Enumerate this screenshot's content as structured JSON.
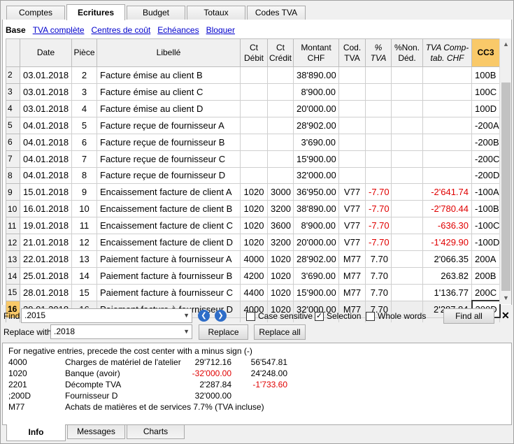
{
  "top_tabs": [
    "Comptes",
    "Ecritures",
    "Budget",
    "Totaux",
    "Codes TVA"
  ],
  "views": {
    "base": "Base",
    "links": [
      "TVA complète",
      "Centres de coût",
      "Echéances",
      "Bloquer"
    ]
  },
  "columns": [
    "Date",
    "Pièce",
    "Libellé",
    "Ct Débit",
    "Ct Crédit",
    "Montant CHF",
    "Cod. TVA",
    "% TVA",
    "%Non. Déd.",
    "TVA Comp-tab. CHF",
    "CC3"
  ],
  "rows": [
    {
      "n": "2",
      "date": "03.01.2018",
      "piece": "2",
      "libelle": "Facture émise au client B",
      "debit": "",
      "credit": "",
      "montant": "38'890.00",
      "codtva": "",
      "pct": "",
      "nonded": "",
      "tvacomp": "",
      "cc3": "100B"
    },
    {
      "n": "3",
      "date": "03.01.2018",
      "piece": "3",
      "libelle": "Facture émise au client C",
      "debit": "",
      "credit": "",
      "montant": "8'900.00",
      "codtva": "",
      "pct": "",
      "nonded": "",
      "tvacomp": "",
      "cc3": "100C"
    },
    {
      "n": "4",
      "date": "03.01.2018",
      "piece": "4",
      "libelle": "Facture émise au client D",
      "debit": "",
      "credit": "",
      "montant": "20'000.00",
      "codtva": "",
      "pct": "",
      "nonded": "",
      "tvacomp": "",
      "cc3": "100D"
    },
    {
      "n": "5",
      "date": "04.01.2018",
      "piece": "5",
      "libelle": "Facture reçue de fournisseur A",
      "debit": "",
      "credit": "",
      "montant": "28'902.00",
      "codtva": "",
      "pct": "",
      "nonded": "",
      "tvacomp": "",
      "cc3": "-200A"
    },
    {
      "n": "6",
      "date": "04.01.2018",
      "piece": "6",
      "libelle": "Facture reçue de fournisseur B",
      "debit": "",
      "credit": "",
      "montant": "3'690.00",
      "codtva": "",
      "pct": "",
      "nonded": "",
      "tvacomp": "",
      "cc3": "-200B"
    },
    {
      "n": "7",
      "date": "04.01.2018",
      "piece": "7",
      "libelle": "Facture reçue de fournisseur C",
      "debit": "",
      "credit": "",
      "montant": "15'900.00",
      "codtva": "",
      "pct": "",
      "nonded": "",
      "tvacomp": "",
      "cc3": "-200C"
    },
    {
      "n": "8",
      "date": "04.01.2018",
      "piece": "8",
      "libelle": "Facture reçue de fournisseur D",
      "debit": "",
      "credit": "",
      "montant": "32'000.00",
      "codtva": "",
      "pct": "",
      "nonded": "",
      "tvacomp": "",
      "cc3": "-200D"
    },
    {
      "n": "9",
      "date": "15.01.2018",
      "piece": "9",
      "libelle": "Encaissement facture de client A",
      "debit": "1020",
      "credit": "3000",
      "montant": "36'950.00",
      "codtva": "V77",
      "pct": "-7.70",
      "nonded": "",
      "tvacomp": "-2'641.74",
      "cc3": "-100A"
    },
    {
      "n": "10",
      "date": "16.01.2018",
      "piece": "10",
      "libelle": "Encaissement facture de client B",
      "debit": "1020",
      "credit": "3200",
      "montant": "38'890.00",
      "codtva": "V77",
      "pct": "-7.70",
      "nonded": "",
      "tvacomp": "-2'780.44",
      "cc3": "-100B"
    },
    {
      "n": "11",
      "date": "19.01.2018",
      "piece": "11",
      "libelle": "Encaissement facture de client C",
      "debit": "1020",
      "credit": "3600",
      "montant": "8'900.00",
      "codtva": "V77",
      "pct": "-7.70",
      "nonded": "",
      "tvacomp": "-636.30",
      "cc3": "-100C"
    },
    {
      "n": "12",
      "date": "21.01.2018",
      "piece": "12",
      "libelle": "Encaissement facture de client D",
      "debit": "1020",
      "credit": "3200",
      "montant": "20'000.00",
      "codtva": "V77",
      "pct": "-7.70",
      "nonded": "",
      "tvacomp": "-1'429.90",
      "cc3": "-100D"
    },
    {
      "n": "13",
      "date": "22.01.2018",
      "piece": "13",
      "libelle": "Paiement facture à fournisseur A",
      "debit": "4000",
      "credit": "1020",
      "montant": "28'902.00",
      "codtva": "M77",
      "pct": "7.70",
      "nonded": "",
      "tvacomp": "2'066.35",
      "cc3": "200A"
    },
    {
      "n": "14",
      "date": "25.01.2018",
      "piece": "14",
      "libelle": "Paiement facture à fournisseur B",
      "debit": "4200",
      "credit": "1020",
      "montant": "3'690.00",
      "codtva": "M77",
      "pct": "7.70",
      "nonded": "",
      "tvacomp": "263.82",
      "cc3": "200B"
    },
    {
      "n": "15",
      "date": "28.01.2018",
      "piece": "15",
      "libelle": "Paiement facture à fournisseur C",
      "debit": "4400",
      "credit": "1020",
      "montant": "15'900.00",
      "codtva": "M77",
      "pct": "7.70",
      "nonded": "",
      "tvacomp": "1'136.77",
      "cc3": "200C"
    },
    {
      "n": "16",
      "date": "29.01.2018",
      "piece": "16",
      "libelle": "Paiement facture à fournisseur D",
      "debit": "4000",
      "credit": "1020",
      "montant": "32'000.00",
      "codtva": "M77",
      "pct": "7.70",
      "nonded": "",
      "tvacomp": "2'287.84",
      "cc3": "200D"
    }
  ],
  "find": {
    "label": "Find",
    "value": ".2015",
    "case_sensitive": "Case sensitive",
    "selection": "Selection",
    "whole_words": "Whole words",
    "find_all": "Find all",
    "close": "✕"
  },
  "replace": {
    "label": "Replace with",
    "value": ".2018",
    "replace_btn": "Replace",
    "replace_all_btn": "Replace all"
  },
  "info": {
    "note": "For negative entries, precede the cost center with a minus sign (-)",
    "lines": [
      {
        "code": "4000",
        "desc": "Charges de matériel de l'atelier",
        "v1": "29'712.16",
        "v2": "56'547.81"
      },
      {
        "code": "1020",
        "desc": "Banque (avoir)",
        "v1": "-32'000.00",
        "v2": "24'248.00"
      },
      {
        "code": "2201",
        "desc": "Décompte TVA",
        "v1": "2'287.84",
        "v2": "-1'733.60"
      },
      {
        "code": ";200D",
        "desc": "Fournisseur D",
        "v1": "32'000.00",
        "v2": ""
      },
      {
        "code": "M77",
        "desc": "Achats de matières et de services 7.7% (TVA incluse)",
        "v1": "",
        "v2": ""
      }
    ]
  },
  "bottom_tabs": [
    "Info",
    "Messages",
    "Charts"
  ]
}
